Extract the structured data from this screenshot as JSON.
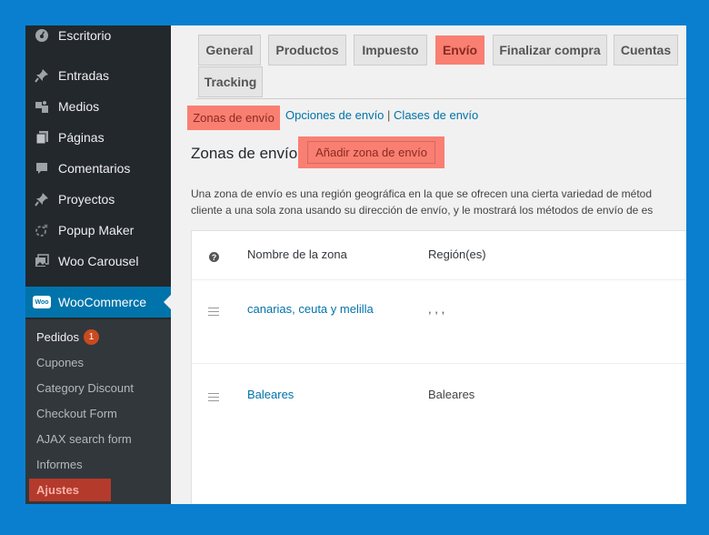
{
  "sidebar": {
    "items": [
      {
        "label": "Escritorio",
        "icon": "dashboard-icon"
      },
      {
        "label": "Entradas",
        "icon": "pin-icon"
      },
      {
        "label": "Medios",
        "icon": "media-icon"
      },
      {
        "label": "Páginas",
        "icon": "pages-icon"
      },
      {
        "label": "Comentarios",
        "icon": "comment-icon"
      },
      {
        "label": "Proyectos",
        "icon": "pin-icon"
      },
      {
        "label": "Popup Maker",
        "icon": "popup-icon"
      },
      {
        "label": "Woo Carousel",
        "icon": "gallery-icon"
      },
      {
        "label": "WooCommerce",
        "icon": "woo-icon"
      }
    ],
    "woo_icon_text": "Woo",
    "submenu": [
      {
        "label": "Pedidos",
        "badge": "1"
      },
      {
        "label": "Cupones"
      },
      {
        "label": "Category Discount"
      },
      {
        "label": "Checkout Form"
      },
      {
        "label": "AJAX search form"
      },
      {
        "label": "Informes"
      },
      {
        "label": "Ajustes"
      }
    ]
  },
  "tabs": [
    "General",
    "Productos",
    "Impuesto",
    "Envío",
    "Finalizar compra",
    "Cuentas",
    "Tracking"
  ],
  "sections": {
    "current": "Zonas de envío",
    "options": "Opciones de envío",
    "separator": "|",
    "classes": "Clases de envío"
  },
  "heading": "Zonas de envío",
  "add_zone_button": "Añadir zona de envío",
  "description": {
    "line1": "Una zona de envío es una región geográfica en la que se ofrecen una cierta variedad de métod",
    "line2": "cliente a una sola zona usando su dirección de envío, y le mostrará los métodos de envío de es"
  },
  "table": {
    "help_icon": "?",
    "headers": {
      "zone_name": "Nombre de la zona",
      "regions": "Región(es)"
    },
    "rows": [
      {
        "name": "canarias, ceuta y melilla",
        "regions": ", , ,"
      },
      {
        "name": "Baleares",
        "regions": "Baleares"
      }
    ]
  },
  "colors": {
    "highlight": "#f97f72",
    "wp_blue": "#0073aa",
    "sidebar": "#23282d",
    "frame": "#0a7fd0"
  }
}
